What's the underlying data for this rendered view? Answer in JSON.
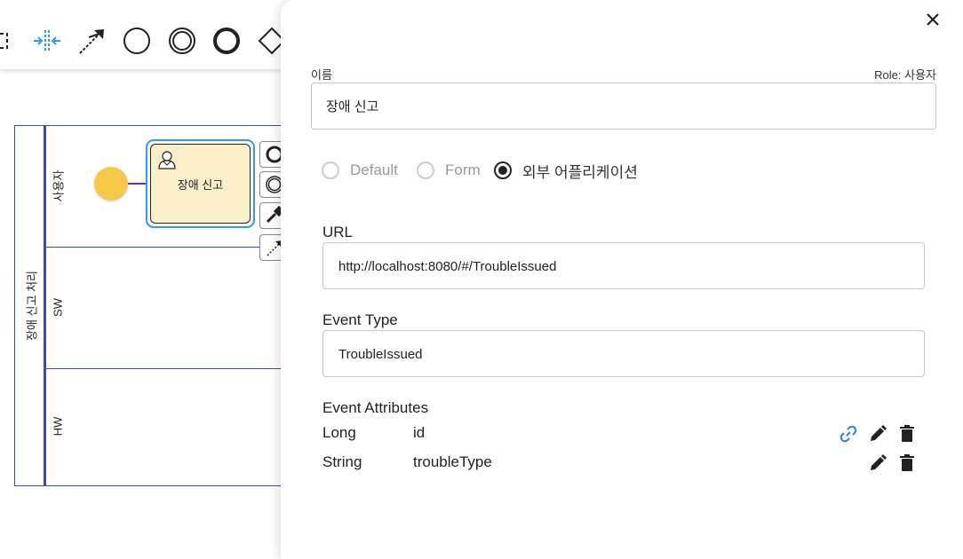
{
  "canvas": {
    "pool_label": "장애 신고 처리",
    "lanes": [
      {
        "label": "사용자"
      },
      {
        "label": "SW"
      },
      {
        "label": "HW"
      }
    ],
    "task_label": "장애 신고"
  },
  "panel": {
    "name_label": "이름",
    "role_text": "Role: 사용자",
    "name_value": "장애 신고",
    "radio_options": [
      {
        "label": "Default",
        "checked": false
      },
      {
        "label": "Form",
        "checked": false
      },
      {
        "label": "외부 어플리케이션",
        "checked": true
      }
    ],
    "url_title": "URL",
    "url_value": "http://localhost:8080/#/TroubleIssued",
    "event_type_title": "Event Type",
    "event_type_value": "TroubleIssued",
    "event_attributes_title": "Event Attributes",
    "attributes": [
      {
        "type": "Long",
        "name": "id",
        "actions": [
          "link-icon",
          "edit-icon",
          "delete-icon"
        ]
      },
      {
        "type": "String",
        "name": "troubleType",
        "actions": [
          "edit-icon",
          "delete-icon"
        ]
      }
    ]
  },
  "colors": {
    "lane_border": "#3c4aa8",
    "task_selected": "#2f9bf0",
    "task_fill": "#fbefc9",
    "start_event": "#f7c948",
    "flow_arrow": "#6b2fa0",
    "link_icon": "#2f7fe0"
  }
}
